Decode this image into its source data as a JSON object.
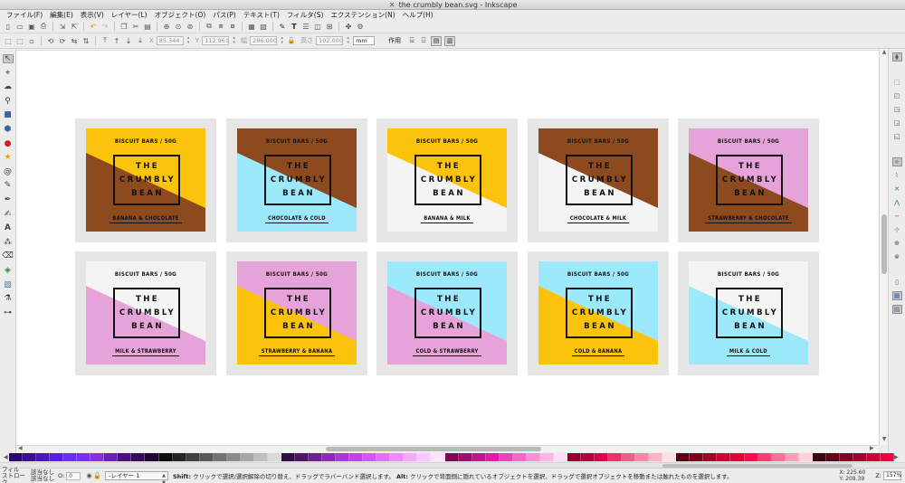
{
  "window": {
    "title": "the crumbly bean.svg - Inkscape"
  },
  "menu": [
    "ファイル(F)",
    "編集(E)",
    "表示(V)",
    "レイヤー(L)",
    "オブジェクト(O)",
    "パス(P)",
    "テキスト(T)",
    "フィルタ(S)",
    "エクステンション(N)",
    "ヘルプ(H)"
  ],
  "tool_controls": {
    "x_label": "X",
    "x_value": "85.344",
    "y_label": "Y",
    "y_value": "112.961",
    "w_label": "幅",
    "w_value": "286.000",
    "h_label": "高さ",
    "h_value": "102.000",
    "unit": "mm",
    "affect_label": "作用"
  },
  "labels": {
    "top_text": "BISCUIT BARS / 50G",
    "brand": [
      "THE",
      "CRUMBLY",
      "BEAN"
    ]
  },
  "designs": [
    {
      "flavor": "BANANA & CHOCOLATE",
      "top_color": "#fcc30c",
      "bottom_color": "#8e4a1f"
    },
    {
      "flavor": "CHOCOLATE & COLD",
      "top_color": "#8e4a1f",
      "bottom_color": "#9de9fc"
    },
    {
      "flavor": "BANANA & MILK",
      "top_color": "#fcc30c",
      "bottom_color": "#f4f4f4"
    },
    {
      "flavor": "CHOCOLATE & MILK",
      "top_color": "#8e4a1f",
      "bottom_color": "#f4f4f4"
    },
    {
      "flavor": "STRAWBERRY & CHOCOLATE",
      "top_color": "#e6a3d9",
      "bottom_color": "#8e4a1f"
    },
    {
      "flavor": "MILK & STRAWBERRY",
      "top_color": "#f4f4f4",
      "bottom_color": "#e6a3d9"
    },
    {
      "flavor": "STRAWBERRY & BANANA",
      "top_color": "#e6a3d9",
      "bottom_color": "#fcc30c"
    },
    {
      "flavor": "COLD & STRAWBERRY",
      "top_color": "#9de9fc",
      "bottom_color": "#e6a3d9"
    },
    {
      "flavor": "COLD & BANANA",
      "top_color": "#9de9fc",
      "bottom_color": "#fcc30c"
    },
    {
      "flavor": "MILK & COLD",
      "top_color": "#f4f4f4",
      "bottom_color": "#9de9fc"
    }
  ],
  "palette": [
    "#2a0a6e",
    "#3a0f9e",
    "#4b14c8",
    "#5a1cf0",
    "#6e2dfc",
    "#7d2cff",
    "#8a2ee6",
    "#6e1eb4",
    "#4d117d",
    "#360b58",
    "#1e0733",
    "#0d0d0d",
    "#262626",
    "#404040",
    "#595959",
    "#737373",
    "#8c8c8c",
    "#a6a6a6",
    "#bfbfbf",
    "#d9d9d9",
    "#2e0f3f",
    "#4c1866",
    "#6b228e",
    "#8a2cb6",
    "#a936de",
    "#c040f6",
    "#d257fb",
    "#e26ffc",
    "#ed8bfd",
    "#f6aafe",
    "#fbc9ff",
    "#ffe3ff",
    "#7a0a55",
    "#a10e70",
    "#c8128c",
    "#ef16a7",
    "#f53fb7",
    "#f867c7",
    "#fa8fd6",
    "#fcb7e6",
    "#fedff5",
    "#8f0030",
    "#b8003e",
    "#e1004c",
    "#f22d6a",
    "#f55a88",
    "#f887a6",
    "#fbb4c4",
    "#fde1e2",
    "#5a0016",
    "#82001f",
    "#aa0028",
    "#d10031",
    "#e5003a",
    "#ff0a52",
    "#ff3c74",
    "#ff6e96",
    "#ffa0b8",
    "#ffd2da",
    "#3d0010",
    "#61001a",
    "#850024",
    "#a9002e",
    "#cd0038",
    "#f10042"
  ],
  "status": {
    "fill_label": "フィル",
    "stroke_label": "ストローク",
    "fill_value": "該当なし",
    "stroke_value": "該当なし",
    "opacity_label": "O:",
    "opacity_value": "0",
    "layer": "-レイヤー 1",
    "message_bold1": "Shift:",
    "message1": " クリックで選択/選択解除の切り替え、ドラッグでラバーバンド選択します。",
    "message_bold2": "Alt:",
    "message2": " クリックで背面側に隠れているオブジェクトを選択、ドラッグで選択オブジェクトを移動または触れたものを選択します。",
    "x_label": "X:",
    "x_value": "225.60",
    "y_label": "Y:",
    "y_value": "209.39",
    "zoom_label": "Z:",
    "zoom_value": "157%"
  }
}
